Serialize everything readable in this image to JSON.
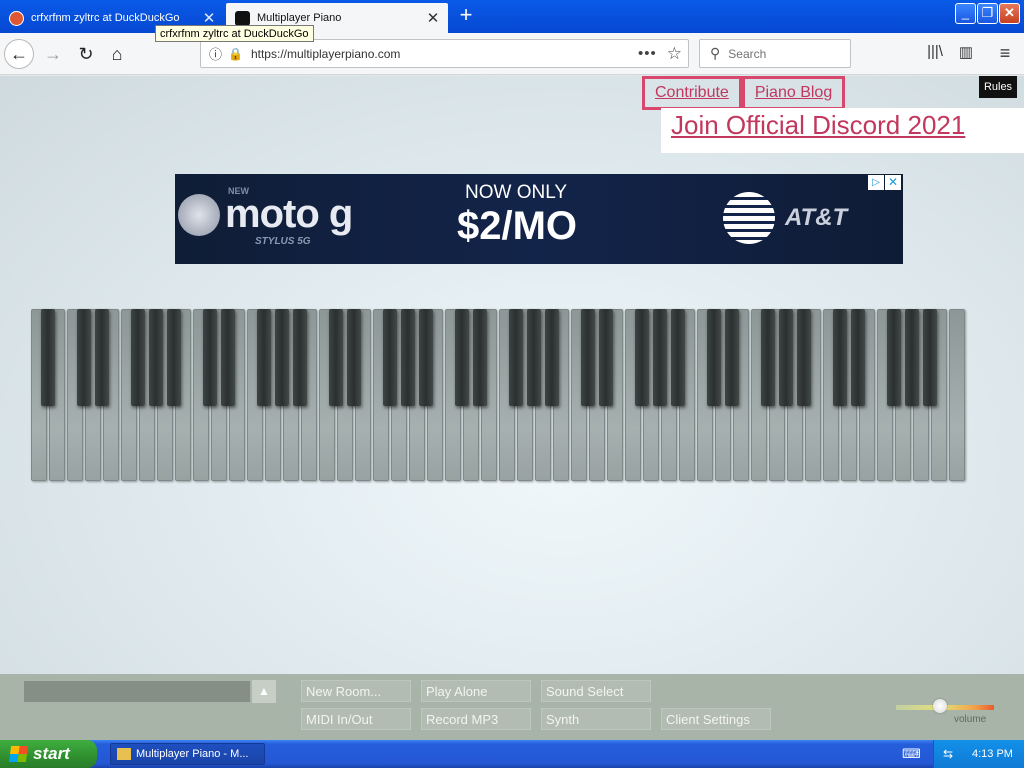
{
  "browser": {
    "tabs": [
      {
        "title": "crfxrfnm zyltrc at DuckDuckGo",
        "active": false
      },
      {
        "title": "Multiplayer Piano",
        "active": true
      }
    ],
    "tooltip": "crfxrfnm zyltrc at DuckDuckGo",
    "url": "https://multiplayerpiano.com",
    "search_placeholder": "Search",
    "icons": {
      "back": "back-arrow-icon",
      "forward": "forward-arrow-icon",
      "reload": "reload-icon",
      "home": "home-icon",
      "info": "info-icon",
      "insecure": "insecure-lock-icon",
      "page_actions": "more-dots-icon",
      "bookmark": "star-icon",
      "library": "library-icon",
      "sidebar": "sidebar-icon",
      "menu": "hamburger-menu-icon",
      "new_tab": "plus-icon"
    }
  },
  "page": {
    "rules_label": "Rules",
    "links": {
      "contribute": "Contribute",
      "piano_blog": "Piano Blog",
      "discord": "Join Official Discord 2021"
    },
    "ad": {
      "brand_tag": "NEW",
      "brand": "moto g",
      "brand_sub": "STYLUS 5G",
      "headline": "NOW ONLY",
      "price": "$2/MO",
      "advertiser": "AT&T",
      "adchoices_icon": "adchoices-icon",
      "close_icon": "close-icon"
    },
    "piano": {
      "white_keys": 52,
      "black_keys": 36
    },
    "controls": {
      "chat_toggle_icon": "triangle-up-icon",
      "new_room": "New Room...",
      "play_alone": "Play Alone",
      "sound_select": "Sound Select",
      "midi": "MIDI In/Out",
      "record_mp3": "Record MP3",
      "synth": "Synth",
      "client_settings": "Client Settings",
      "volume_label": "volume",
      "volume_level": 0.45
    }
  },
  "taskbar": {
    "start_label": "start",
    "task_item": "Multiplayer Piano - M...",
    "clock": "4:13 PM"
  },
  "colors": {
    "link_pink": "#c2375d",
    "link_border": "#d8486c",
    "xp_blue": "#245edb",
    "start_green": "#2f8f2f"
  }
}
